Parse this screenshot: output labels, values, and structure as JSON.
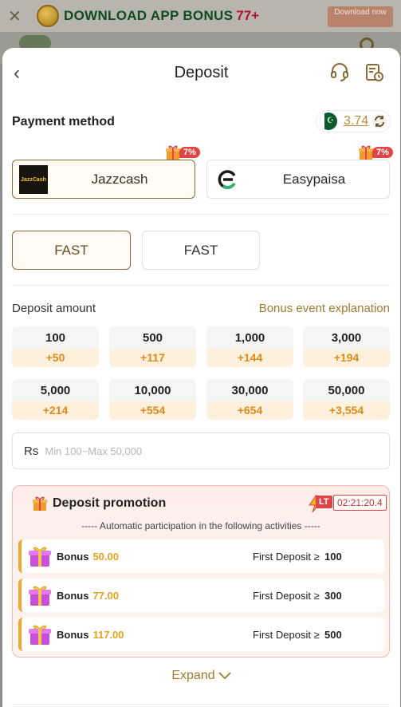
{
  "banner": {
    "text": "DOWNLOAD APP BONUS",
    "number": "77+",
    "download_label": "Download now"
  },
  "header": {
    "title": "Deposit"
  },
  "payment": {
    "label": "Payment method",
    "balance": "3.74",
    "methods": [
      {
        "name": "Jazzcash",
        "badge": "7%",
        "selected": true
      },
      {
        "name": "Easypaisa",
        "badge": "7%",
        "selected": false
      }
    ],
    "channels": [
      {
        "label": "FAST",
        "selected": true
      },
      {
        "label": "FAST",
        "selected": false
      }
    ]
  },
  "amount": {
    "label": "Deposit amount",
    "bonus_link": "Bonus event explanation",
    "options": [
      {
        "value": "100",
        "bonus": "+50"
      },
      {
        "value": "500",
        "bonus": "+117"
      },
      {
        "value": "1,000",
        "bonus": "+144"
      },
      {
        "value": "3,000",
        "bonus": "+194"
      },
      {
        "value": "5,000",
        "bonus": "+214"
      },
      {
        "value": "10,000",
        "bonus": "+554"
      },
      {
        "value": "30,000",
        "bonus": "+654"
      },
      {
        "value": "50,000",
        "bonus": "+3,554"
      }
    ],
    "currency": "Rs",
    "placeholder": "Min 100~Max 50,000"
  },
  "promotion": {
    "title": "Deposit promotion",
    "lt_label": "LT",
    "timer": "02:21:20.4",
    "auto_text": "----- Automatic participation in the following activities -----",
    "rows": [
      {
        "bonus_label": "Bonus",
        "bonus_value": "50.00",
        "condition": "First Deposit ≥",
        "threshold": "100"
      },
      {
        "bonus_label": "Bonus",
        "bonus_value": "77.00",
        "condition": "First Deposit ≥",
        "threshold": "300"
      },
      {
        "bonus_label": "Bonus",
        "bonus_value": "117.00",
        "condition": "First Deposit ≥",
        "threshold": "500"
      }
    ],
    "expand_label": "Expand"
  },
  "colors": {
    "accent": "#a27b2e",
    "bonus_orange": "#e08a1a",
    "badge_red": "#e04545"
  }
}
